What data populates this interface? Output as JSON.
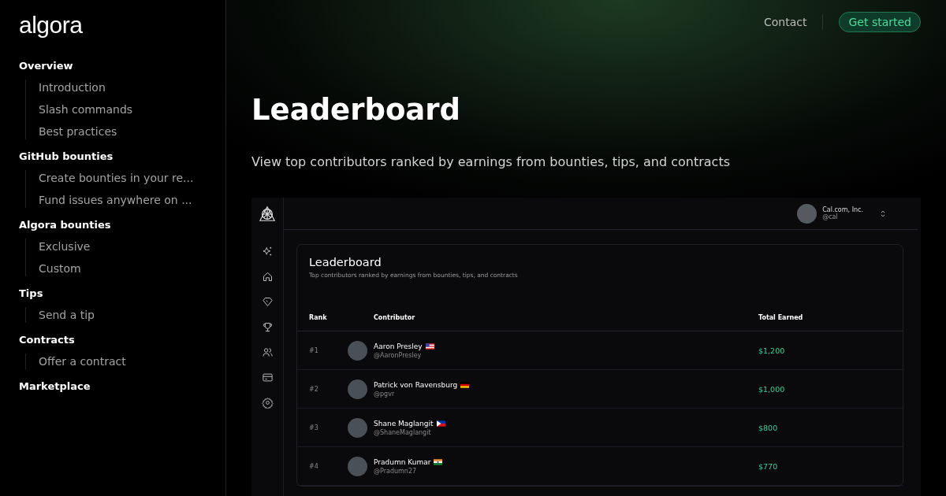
{
  "logo": "algora",
  "sidebar": {
    "sections": [
      {
        "title": "Overview",
        "items": [
          "Introduction",
          "Slash commands",
          "Best practices"
        ]
      },
      {
        "title": "GitHub bounties",
        "items": [
          "Create bounties in your re...",
          "Fund issues anywhere on ..."
        ]
      },
      {
        "title": "Algora bounties",
        "items": [
          "Exclusive",
          "Custom"
        ]
      },
      {
        "title": "Tips",
        "items": [
          "Send a tip"
        ]
      },
      {
        "title": "Contracts",
        "items": [
          "Offer a contract"
        ]
      },
      {
        "title": "Marketplace"
      }
    ]
  },
  "header": {
    "links": [
      "Contact"
    ],
    "cta": "Get started"
  },
  "page": {
    "title": "Leaderboard",
    "subtitle": "View top contributors ranked by earnings from bounties, tips, and contracts"
  },
  "preview": {
    "rail_icons": [
      {
        "kind": "sparkles"
      },
      {
        "kind": "home"
      },
      {
        "kind": "diamond"
      },
      {
        "kind": "trophy"
      },
      {
        "kind": "users"
      },
      {
        "kind": "card"
      },
      {
        "kind": "settings"
      }
    ],
    "org": {
      "name": "Cal.com, Inc.",
      "handle": "@cal"
    },
    "card": {
      "title": "Leaderboard",
      "subtitle": "Top contributors ranked by earnings from bounties, tips, and contracts"
    },
    "columns": [
      "Rank",
      "Contributor",
      "Total Earned"
    ],
    "rows": [
      {
        "rank": "#1",
        "name": "Aaron Presley",
        "handle": "@AaronPresley",
        "flag": {
          "kind": "us"
        },
        "earned": "$1,200"
      },
      {
        "rank": "#2",
        "name": "Patrick von Ravensburg",
        "handle": "@pgvr",
        "flag": {
          "kind": "de"
        },
        "earned": "$1,000"
      },
      {
        "rank": "#3",
        "name": "Shane Maglangit",
        "handle": "@ShaneMaglangit",
        "flag": {
          "kind": "ph"
        },
        "earned": "$800"
      },
      {
        "rank": "#4",
        "name": "Pradumn Kumar",
        "handle": "@Pradumn27",
        "flag": {
          "kind": "in"
        },
        "earned": "$770"
      }
    ]
  }
}
